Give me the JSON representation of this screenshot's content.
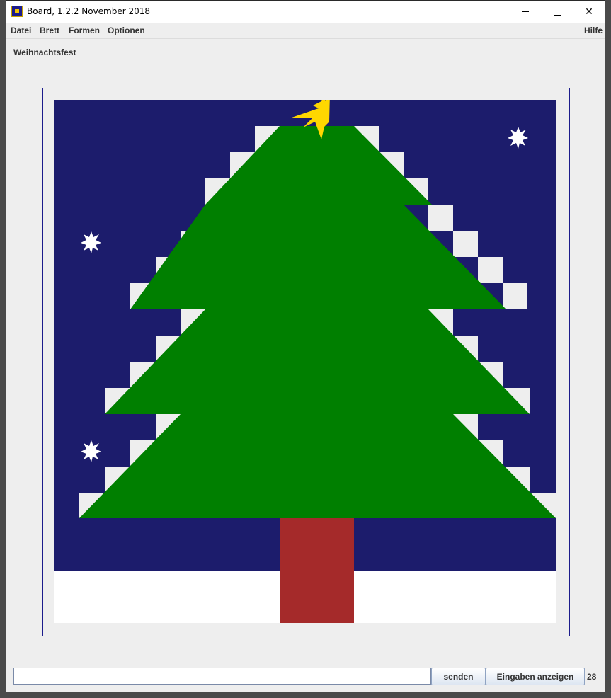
{
  "window": {
    "title": "Board, 1.2.2 November 2018",
    "controls": {
      "minimize": "",
      "maximize": "",
      "close": "✕"
    }
  },
  "menu": {
    "items": [
      "Datei",
      "Brett",
      "Formen",
      "Optionen"
    ],
    "help": "Hilfe"
  },
  "board": {
    "title": "Weihnachtsfest",
    "colors": {
      "sky": "#1c1c6c",
      "snow": "#ffffff",
      "snowStep": "#eeeeee",
      "tree": "#007f00",
      "trunk": "#a52a2a",
      "star": "#ffd700",
      "snowflake": "#ffffff",
      "frame": "#1c1c8c"
    }
  },
  "footer": {
    "input_value": "",
    "send_label": "senden",
    "show_label": "Eingaben anzeigen",
    "count": "28"
  }
}
